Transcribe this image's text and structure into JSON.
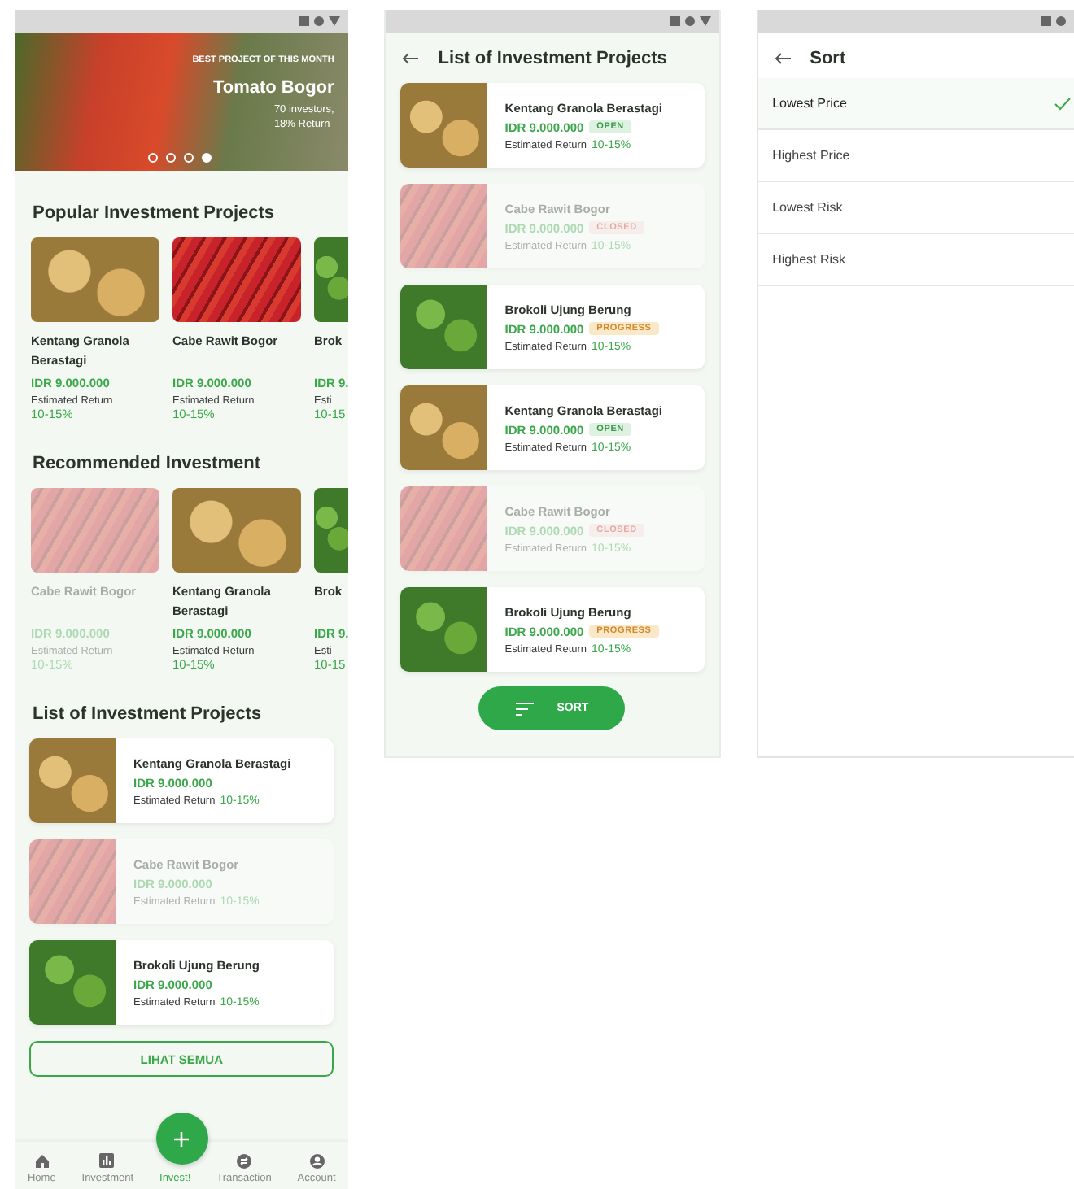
{
  "home": {
    "hero": {
      "label": "BEST PROJECT OF THIS MONTH",
      "title": "Tomato Bogor",
      "details": [
        "70 investors,",
        "18% Return"
      ],
      "dots": [
        {
          "selected": false
        },
        {
          "selected": false
        },
        {
          "selected": false
        },
        {
          "selected": true
        }
      ]
    },
    "popular": {
      "title": "Popular Investment Projects",
      "cards": [
        {
          "name": "Kentang Granola Berastagi",
          "kind": "potato",
          "price": "IDR 9.000.000",
          "return_label": "Estimated Return",
          "return": "10-15%",
          "closed": false
        },
        {
          "name": "Cabe Rawit Bogor",
          "kind": "chili",
          "price": "IDR 9.000.000",
          "return_label": "Estimated Return",
          "return": "10-15%",
          "closed": false
        },
        {
          "name": "Brok",
          "kind": "broccoli",
          "price": "IDR 9.",
          "return_label": "Esti",
          "return": "10-15",
          "closed": false
        }
      ]
    },
    "recommended": {
      "title": "Recommended Investment",
      "cards": [
        {
          "name": "Cabe Rawit Bogor",
          "kind": "chili",
          "price": "IDR 9.000.000",
          "return_label": "Estimated Return",
          "return": "10-15%",
          "closed": true
        },
        {
          "name": "Kentang Granola Berastagi",
          "kind": "potato",
          "price": "IDR 9.000.000",
          "return_label": "Estimated Return",
          "return": "10-15%",
          "closed": false
        },
        {
          "name": "Brok",
          "kind": "broccoli",
          "price": "IDR 9.",
          "return_label": "Esti",
          "return": "10-15",
          "closed": false
        }
      ]
    },
    "list": {
      "title": "List of Investment Projects",
      "items": [
        {
          "name": "Kentang Granola Berastagi",
          "kind": "potato",
          "price": "IDR 9.000.000",
          "return_label": "Estimated Return",
          "return": "10-15%",
          "closed": false
        },
        {
          "name": "Cabe Rawit Bogor",
          "kind": "chili",
          "price": "IDR 9.000.000",
          "return_label": "Estimated Return",
          "return": "10-15%",
          "closed": true
        },
        {
          "name": "Brokoli Ujung Berung",
          "kind": "broccoli",
          "price": "IDR 9.000.000",
          "return_label": "Estimated Return",
          "return": "10-15%",
          "closed": false
        }
      ],
      "button": "LIHAT SEMUA"
    },
    "nav": [
      {
        "label": "Home",
        "kind": "home",
        "selected": false
      },
      {
        "label": "Investment",
        "kind": "chart",
        "selected": false
      },
      {
        "label": "Invest!",
        "kind": "plus",
        "selected": true
      },
      {
        "label": "Transaction",
        "kind": "swap",
        "selected": false
      },
      {
        "label": "Account",
        "kind": "account",
        "selected": false
      }
    ]
  },
  "project_list": {
    "title": "List of Investment Projects",
    "items": [
      {
        "name": "Kentang Granola Berastagi",
        "kind": "potato",
        "price": "IDR 9.000.000",
        "badge": {
          "kind": "open",
          "label": "OPEN"
        },
        "return_label": "Estimated Return",
        "return": "10-15%"
      },
      {
        "name": "Cabe Rawit Bogor",
        "kind": "chili",
        "price": "IDR 9.000.000",
        "badge": {
          "kind": "closed",
          "label": "CLOSED"
        },
        "return_label": "Estimated Return",
        "return": "10-15%"
      },
      {
        "name": "Brokoli Ujung Berung",
        "kind": "broccoli",
        "price": "IDR 9.000.000",
        "badge": {
          "kind": "progress",
          "label": "PROGRESS"
        },
        "return_label": "Estimated Return",
        "return": "10-15%"
      },
      {
        "name": "Kentang Granola Berastagi",
        "kind": "potato",
        "price": "IDR 9.000.000",
        "badge": {
          "kind": "open",
          "label": "OPEN"
        },
        "return_label": "Estimated Return",
        "return": "10-15%"
      },
      {
        "name": "Cabe Rawit Bogor",
        "kind": "chili",
        "price": "IDR 9.000.000",
        "badge": {
          "kind": "closed",
          "label": "CLOSED"
        },
        "return_label": "Estimated Return",
        "return": "10-15%"
      },
      {
        "name": "Brokoli Ujung Berung",
        "kind": "broccoli",
        "price": "IDR 9.000.000",
        "badge": {
          "kind": "progress",
          "label": "PROGRESS"
        },
        "return_label": "Estimated Return",
        "return": "10-15%"
      }
    ],
    "button": "SORT"
  },
  "sort": {
    "title": "Sort",
    "options": [
      {
        "label": "Lowest Price",
        "selected": true
      },
      {
        "label": "Highest Price",
        "selected": false
      },
      {
        "label": "Lowest Risk",
        "selected": false
      },
      {
        "label": "Highest Risk",
        "selected": false
      }
    ]
  }
}
